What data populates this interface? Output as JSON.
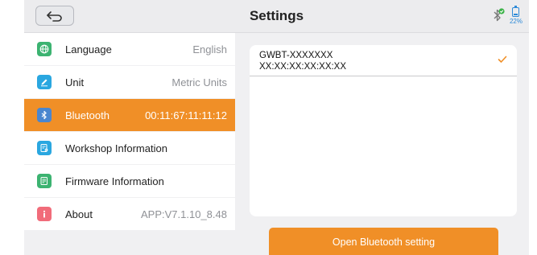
{
  "header": {
    "title": "Settings"
  },
  "status_bar": {
    "bluetooth_icon": "bluetooth-connected-icon",
    "battery_icon": "battery-icon",
    "battery_level": "22%",
    "battery_fraction": 0.22
  },
  "sidebar": {
    "items": [
      {
        "name": "language",
        "label": "Language",
        "value": "English",
        "icon": "globe-icon",
        "color": "#3cb371"
      },
      {
        "name": "unit",
        "label": "Unit",
        "value": "Metric Units",
        "icon": "pencil-icon",
        "color": "#2aa7e0"
      },
      {
        "name": "bluetooth",
        "label": "Bluetooth",
        "value": "00:11:67:11:11:12",
        "icon": "bluetooth-icon",
        "color": "#4a86cf",
        "active": true
      },
      {
        "name": "workshop-information",
        "label": "Workshop Information",
        "value": "",
        "icon": "document-search-icon",
        "color": "#2aa7e0"
      },
      {
        "name": "firmware-information",
        "label": "Firmware Information",
        "value": "",
        "icon": "document-icon",
        "color": "#3cb371"
      },
      {
        "name": "about",
        "label": "About",
        "value": "APP:V7.1.10_8.48",
        "icon": "info-icon",
        "color": "#f16c7a"
      }
    ]
  },
  "device": {
    "name": "GWBT-XXXXXXX",
    "address": "XX:XX:XX:XX:XX:XX",
    "selected": true
  },
  "actions": {
    "open_bluetooth_label": "Open Bluetooth setting"
  },
  "colors": {
    "accent": "#f08f27",
    "background": "#f0f0f2"
  }
}
